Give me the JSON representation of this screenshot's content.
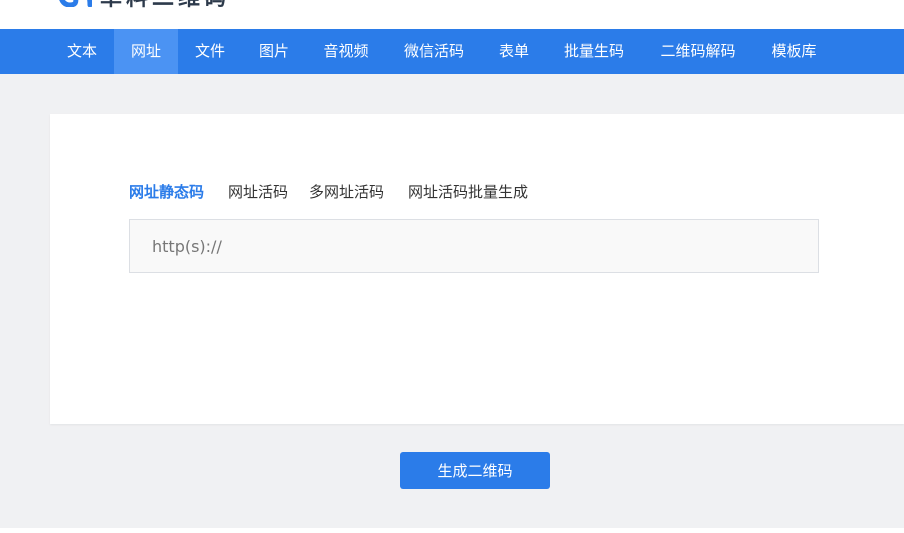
{
  "header": {
    "logo_text": "草料二维码",
    "logo_icon": "logo-mark-icon"
  },
  "nav": {
    "items": [
      {
        "label": "文本"
      },
      {
        "label": "网址",
        "active": true
      },
      {
        "label": "文件"
      },
      {
        "label": "图片"
      },
      {
        "label": "音视频"
      },
      {
        "label": "微信活码"
      },
      {
        "label": "表单"
      },
      {
        "label": "批量生码"
      },
      {
        "label": "二维码解码"
      },
      {
        "label": "模板库"
      }
    ]
  },
  "subtabs": [
    {
      "label": "网址静态码",
      "active": true
    },
    {
      "label": "网址活码"
    },
    {
      "label": "多网址活码"
    },
    {
      "label": "网址活码批量生成"
    }
  ],
  "url_input": {
    "placeholder": "http(s)://",
    "value": ""
  },
  "generate_button": {
    "label": "生成二维码"
  },
  "colors": {
    "accent": "#2b7ce9",
    "nav_active": "#4b93f3",
    "page_bg": "#f0f1f3",
    "input_bg": "#f9f9f9"
  }
}
